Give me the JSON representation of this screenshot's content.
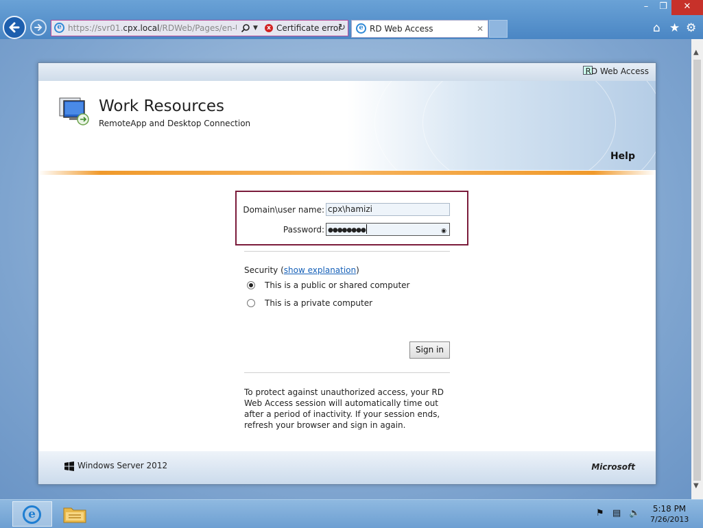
{
  "browser": {
    "address_url_dim": "https://svr01.",
    "address_url_host": "cpx.local",
    "address_url_path": "/RDWeb/Pages/en-US/lc",
    "cert_error": "Certificate error",
    "tab_title": "RD Web Access",
    "cert_error_icon": "x",
    "back_icon": "back-arrow-icon",
    "forward_icon": "forward-arrow-icon"
  },
  "page": {
    "top_bar_label": "RD Web Access",
    "title": "Work Resources",
    "subtitle": "RemoteApp and Desktop Connection",
    "help": "Help",
    "username_label": "Domain\\user name:",
    "username_value": "cpx\\hamizi",
    "password_label": "Password:",
    "password_value": "●●●●●●●●",
    "security_prefix": "Security (",
    "security_link": "show explanation",
    "security_suffix": ")",
    "radio_public": "This is a public or shared computer",
    "radio_private": "This is a private computer",
    "radio_selected": "public",
    "sign_in": "Sign in",
    "notice": "To protect against unauthorized access, your RD Web Access session will automatically time out after a period of inactivity. If your session ends, refresh your browser and sign in again.",
    "footer_product": "Windows Server 2012",
    "footer_brand": "Microsoft"
  },
  "taskbar": {
    "time": "5:18 PM",
    "date": "7/26/2013"
  },
  "colors": {
    "accent_orange": "#f09a2c",
    "highlight_box": "#7a1a3a",
    "link_blue": "#1560b8"
  }
}
